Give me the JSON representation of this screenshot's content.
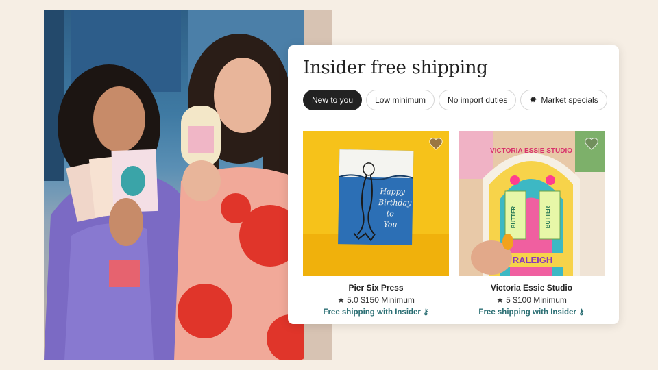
{
  "panel": {
    "title": "Insider free shipping",
    "chips": [
      {
        "label": "New to you",
        "active": true
      },
      {
        "label": "Low minimum",
        "active": false
      },
      {
        "label": "No import duties",
        "active": false
      },
      {
        "label": "Market specials",
        "active": false,
        "icon": "sparkle-icon"
      }
    ]
  },
  "products": [
    {
      "shop": "Pier Six Press",
      "rating": "★ 5.0",
      "minimum": "$150 Minimum",
      "shipping": "Free shipping with Insider",
      "card_text": "Happy Birthday to You"
    },
    {
      "shop": "Victoria Essie Studio",
      "rating": "★ 5",
      "minimum": "$100 Minimum",
      "shipping": "Free shipping with Insider",
      "sign_text": "VICTORIA ESSIE STUDIO",
      "earring_text": "BUTTER",
      "plate_text": "RALEIGH"
    }
  ],
  "colors": {
    "accent_teal": "#2a6e73",
    "chip_active": "#222222"
  }
}
